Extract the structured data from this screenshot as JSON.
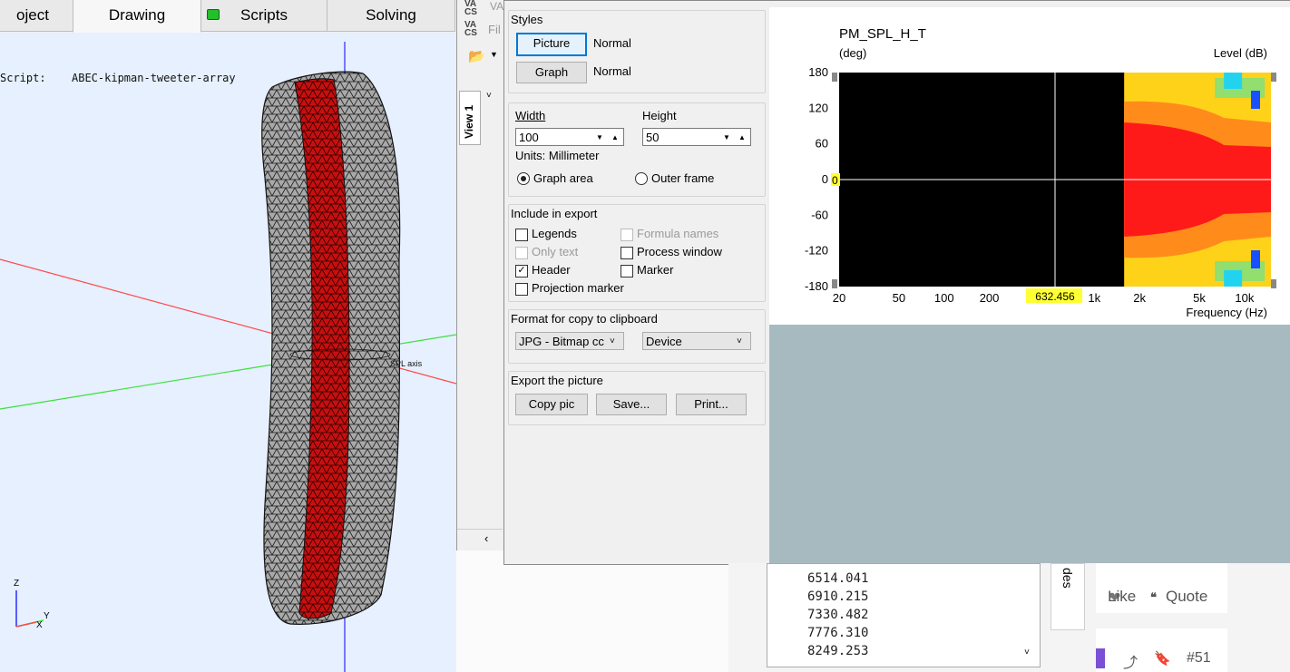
{
  "tabs": [
    "oject",
    "Drawing",
    "Scripts",
    "Solving"
  ],
  "viewport": {
    "script_label": "Script:",
    "script_name": "ABEC-kipman-tweeter-array",
    "axis_z": "Z",
    "axis_y": "Y",
    "axis_x": "X"
  },
  "mid_window": {
    "logo_top": "VA CS",
    "logo_bottom": "VA CS",
    "file_label": "Fil",
    "va_label": "VA",
    "view_tab": "View 1"
  },
  "dialog": {
    "styles": {
      "title": "Styles",
      "picture_btn": "Picture",
      "picture_style": "Normal",
      "graph_btn": "Graph",
      "graph_style": "Normal"
    },
    "size": {
      "width_label": "Width",
      "width_value": "100",
      "height_label": "Height",
      "height_value": "50",
      "units": "Units: Millimeter",
      "graph_area": "Graph area",
      "outer_frame": "Outer frame"
    },
    "include": {
      "title": "Include in export",
      "legends": "Legends",
      "formula_names": "Formula names",
      "only_text": "Only text",
      "process_window": "Process window",
      "header": "Header",
      "marker": "Marker",
      "projection_marker": "Projection marker"
    },
    "format": {
      "title": "Format for copy to clipboard",
      "format_value": "JPG - Bitmap cc",
      "device_value": "Device"
    },
    "export": {
      "title": "Export the picture",
      "copy_btn": "Copy pic",
      "save_btn": "Save...",
      "print_btn": "Print..."
    }
  },
  "chart_data": {
    "type": "heatmap",
    "title": "PM_SPL_H_T",
    "ylabel": "(deg)",
    "xlabel": "Frequency  (Hz)",
    "colorbar_label": "Level  (dB)",
    "y_ticks": [
      "180",
      "120",
      "60",
      "0",
      "-60",
      "-120",
      "-180"
    ],
    "x_ticks": [
      "20",
      "50",
      "100",
      "200",
      "632.456",
      "1k",
      "2k",
      "5k",
      "10k"
    ],
    "marker_y": "0",
    "marker_x": "632.456",
    "colors": {
      "background": "#000000",
      "hot": "#ff1a1a",
      "orange": "#ff8c1a",
      "yellow": "#ffd21a",
      "green": "#7fe07f",
      "cyan": "#22d3f0",
      "blue": "#1a4fff"
    }
  },
  "forum": {
    "values": [
      "6514.041",
      "6910.215",
      "7330.482",
      "7776.310",
      "8249.253"
    ],
    "like": "Like",
    "quote": "Quote",
    "post_number": "#51",
    "side_tab": "des"
  }
}
